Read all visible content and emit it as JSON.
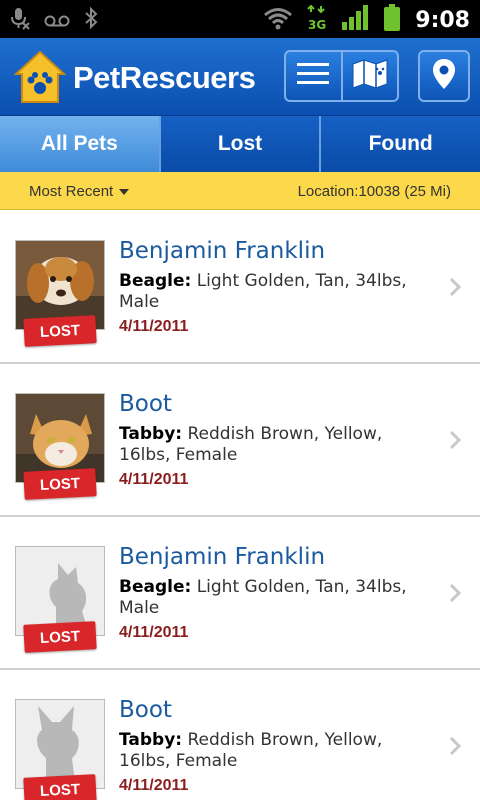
{
  "status_bar": {
    "time": "9:08",
    "icons": [
      "mic-off-icon",
      "voicemail-icon",
      "bluetooth-icon",
      "wifi-icon",
      "3g-icon",
      "signal-icon",
      "battery-icon"
    ]
  },
  "header": {
    "app_name": "PetRescuers",
    "buttons": [
      "menu-icon",
      "map-icon",
      "location-pin-icon"
    ],
    "colors": {
      "primary": "#0b4fb0",
      "accent": "#fcd94a",
      "lost": "#d8262a"
    }
  },
  "tabs": [
    {
      "label": "All Pets",
      "active": true
    },
    {
      "label": "Lost",
      "active": false
    },
    {
      "label": "Found",
      "active": false
    }
  ],
  "filter": {
    "sort_label": "Most Recent",
    "location_label": "Location:10038 (25 Mi)"
  },
  "pets": [
    {
      "name": "Benjamin Franklin",
      "breed": "Beagle:",
      "details": " Light Golden, Tan, 34lbs, Male",
      "date": "4/11/2011",
      "status": "LOST",
      "photo": "dog-photo"
    },
    {
      "name": "Boot",
      "breed": "Tabby:",
      "details": " Reddish Brown, Yellow, 16lbs, Female",
      "date": "4/11/2011",
      "status": "LOST",
      "photo": "cat-photo"
    },
    {
      "name": "Benjamin Franklin",
      "breed": "Beagle:",
      "details": " Light Golden, Tan, 34lbs, Male",
      "date": "4/11/2011",
      "status": "LOST",
      "photo": "cat-silhouette-placeholder"
    },
    {
      "name": "Boot",
      "breed": "Tabby:",
      "details": " Reddish Brown, Yellow, 16lbs, Female",
      "date": "4/11/2011",
      "status": "LOST",
      "photo": "dog-silhouette-placeholder"
    }
  ]
}
